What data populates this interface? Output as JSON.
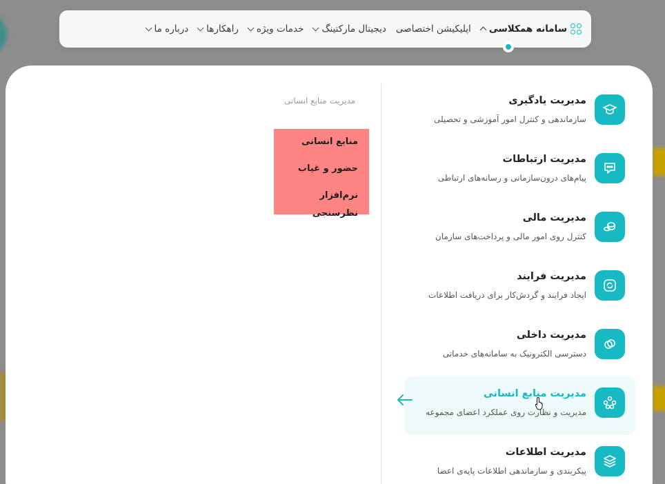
{
  "topnav": {
    "items": [
      {
        "label": "سامانه همکلاسی",
        "active": true,
        "chevron": "up"
      },
      {
        "label": "اپلیکیشن اختصاصی"
      },
      {
        "label": "دیجیتال مارکتینگ",
        "chevron": "down"
      },
      {
        "label": "خدمات ویژه",
        "chevron": "down"
      },
      {
        "label": "راهکارها",
        "chevron": "down"
      },
      {
        "label": "درباره ما",
        "chevron": "down"
      }
    ]
  },
  "menu": {
    "items": [
      {
        "title": "مدیریت یادگیری",
        "desc": "سازماندهی و کنترل امور آموزشی و تحصیلی",
        "icon": "graduation-cap-icon"
      },
      {
        "title": "مدیریت ارتباطات",
        "desc": "پیام‌های درون‌سازمانی و رسانه‌های ارتباطی",
        "icon": "chat-bubble-icon"
      },
      {
        "title": "مدیریت مالی",
        "desc": "کنترل روی امور مالی و پرداخت‌های سازمان",
        "icon": "coins-icon"
      },
      {
        "title": "مدیریت فرایند",
        "desc": "ایجاد فرایند و گردش‌کار برای دریافت اطلاعات",
        "icon": "refresh-cycle-icon"
      },
      {
        "title": "مدیریت داخلی",
        "desc": "دسترسی الکترونیک به سامانه‌های خدماتی",
        "icon": "link-circles-icon"
      },
      {
        "title": "مدیریت منابع انسانی",
        "desc": "مدیریت و نظارت روی عملکرد اعضای مجموعه",
        "icon": "people-network-icon",
        "active": true
      },
      {
        "title": "مدیریت اطلاعات",
        "desc": "پیکربندی و سازماندهی اطلاعات پایه‌ی اعضا",
        "icon": "layers-icon"
      }
    ]
  },
  "submenu": {
    "heading": "مدیریت منابع انسانی",
    "items": [
      "منابع انسانی",
      "حضور و غیاب",
      "نرم‌افزار نظرسنجی"
    ]
  },
  "colors": {
    "accent": "#17b9c3",
    "highlight": "#ff8585",
    "active_bg": "#eef9f9"
  }
}
